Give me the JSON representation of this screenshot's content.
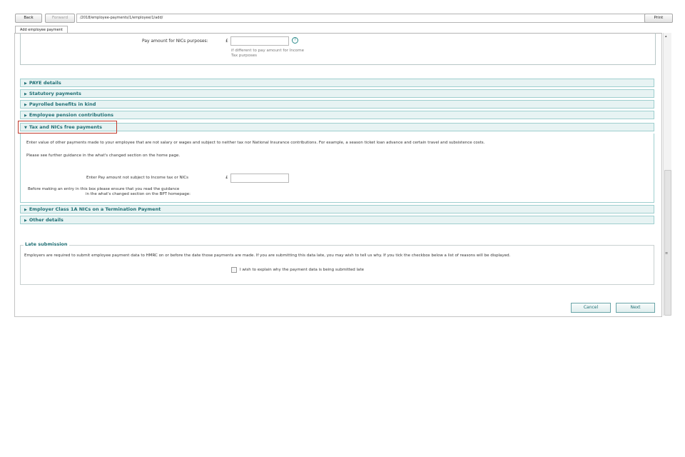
{
  "toolbar": {
    "back_label": "Back",
    "forward_label": "Forward",
    "address": "/2018/employee-payments/1/employee/1/add/",
    "print_label": "Print"
  },
  "tab": {
    "label": "Add employee payment"
  },
  "top_section": {
    "field_label": "Pay amount for NICs purposes:",
    "currency": "£",
    "help_icon": "question-circle-icon",
    "hint_line1": "if different to pay amount for Income",
    "hint_line2": "Tax purposes"
  },
  "accordion": [
    {
      "label": "PAYE details",
      "state": "collapsed"
    },
    {
      "label": "Statutory payments",
      "state": "collapsed"
    },
    {
      "label": "Payrolled benefits in kind",
      "state": "collapsed"
    },
    {
      "label": "Employee pension contributions",
      "state": "collapsed"
    },
    {
      "label": "Tax and NICs free payments",
      "state": "expanded"
    },
    {
      "label": "Employer Class 1A NICs on a Termination Payment",
      "state": "collapsed"
    },
    {
      "label": "Other details",
      "state": "collapsed"
    }
  ],
  "tax_free_section": {
    "intro": "Enter value of other payments made to your employee that are not salary or wages and subject to neither tax nor National Insurance contributions. For example, a season ticket loan advance and certain travel and subsistence costs.",
    "guidance": "Please see further guidance in the what's changed section on the home page.",
    "field_label": "Enter Pay amount not subject to Income tax or NICs",
    "currency": "£",
    "note_line1": "Before making an entry in this box please ensure that you read the guidance",
    "note_line2": "in the what's changed section on the BPT homepage:"
  },
  "late_submission": {
    "legend": "Late submission",
    "text": "Employers are required to submit employee payment data to HMRC on or before the date those payments are made. If you are submitting this data late, you may wish to tell us why. If you tick the checkbox below a list of reasons will be displayed.",
    "checkbox_label": "I wish to explain why the payment data is being submitted late"
  },
  "actions": {
    "cancel_label": "Cancel",
    "next_label": "Next"
  },
  "colors": {
    "accent": "#1f6f74",
    "accordion_bg": "#e7f3f3",
    "highlight": "#c0392b"
  }
}
